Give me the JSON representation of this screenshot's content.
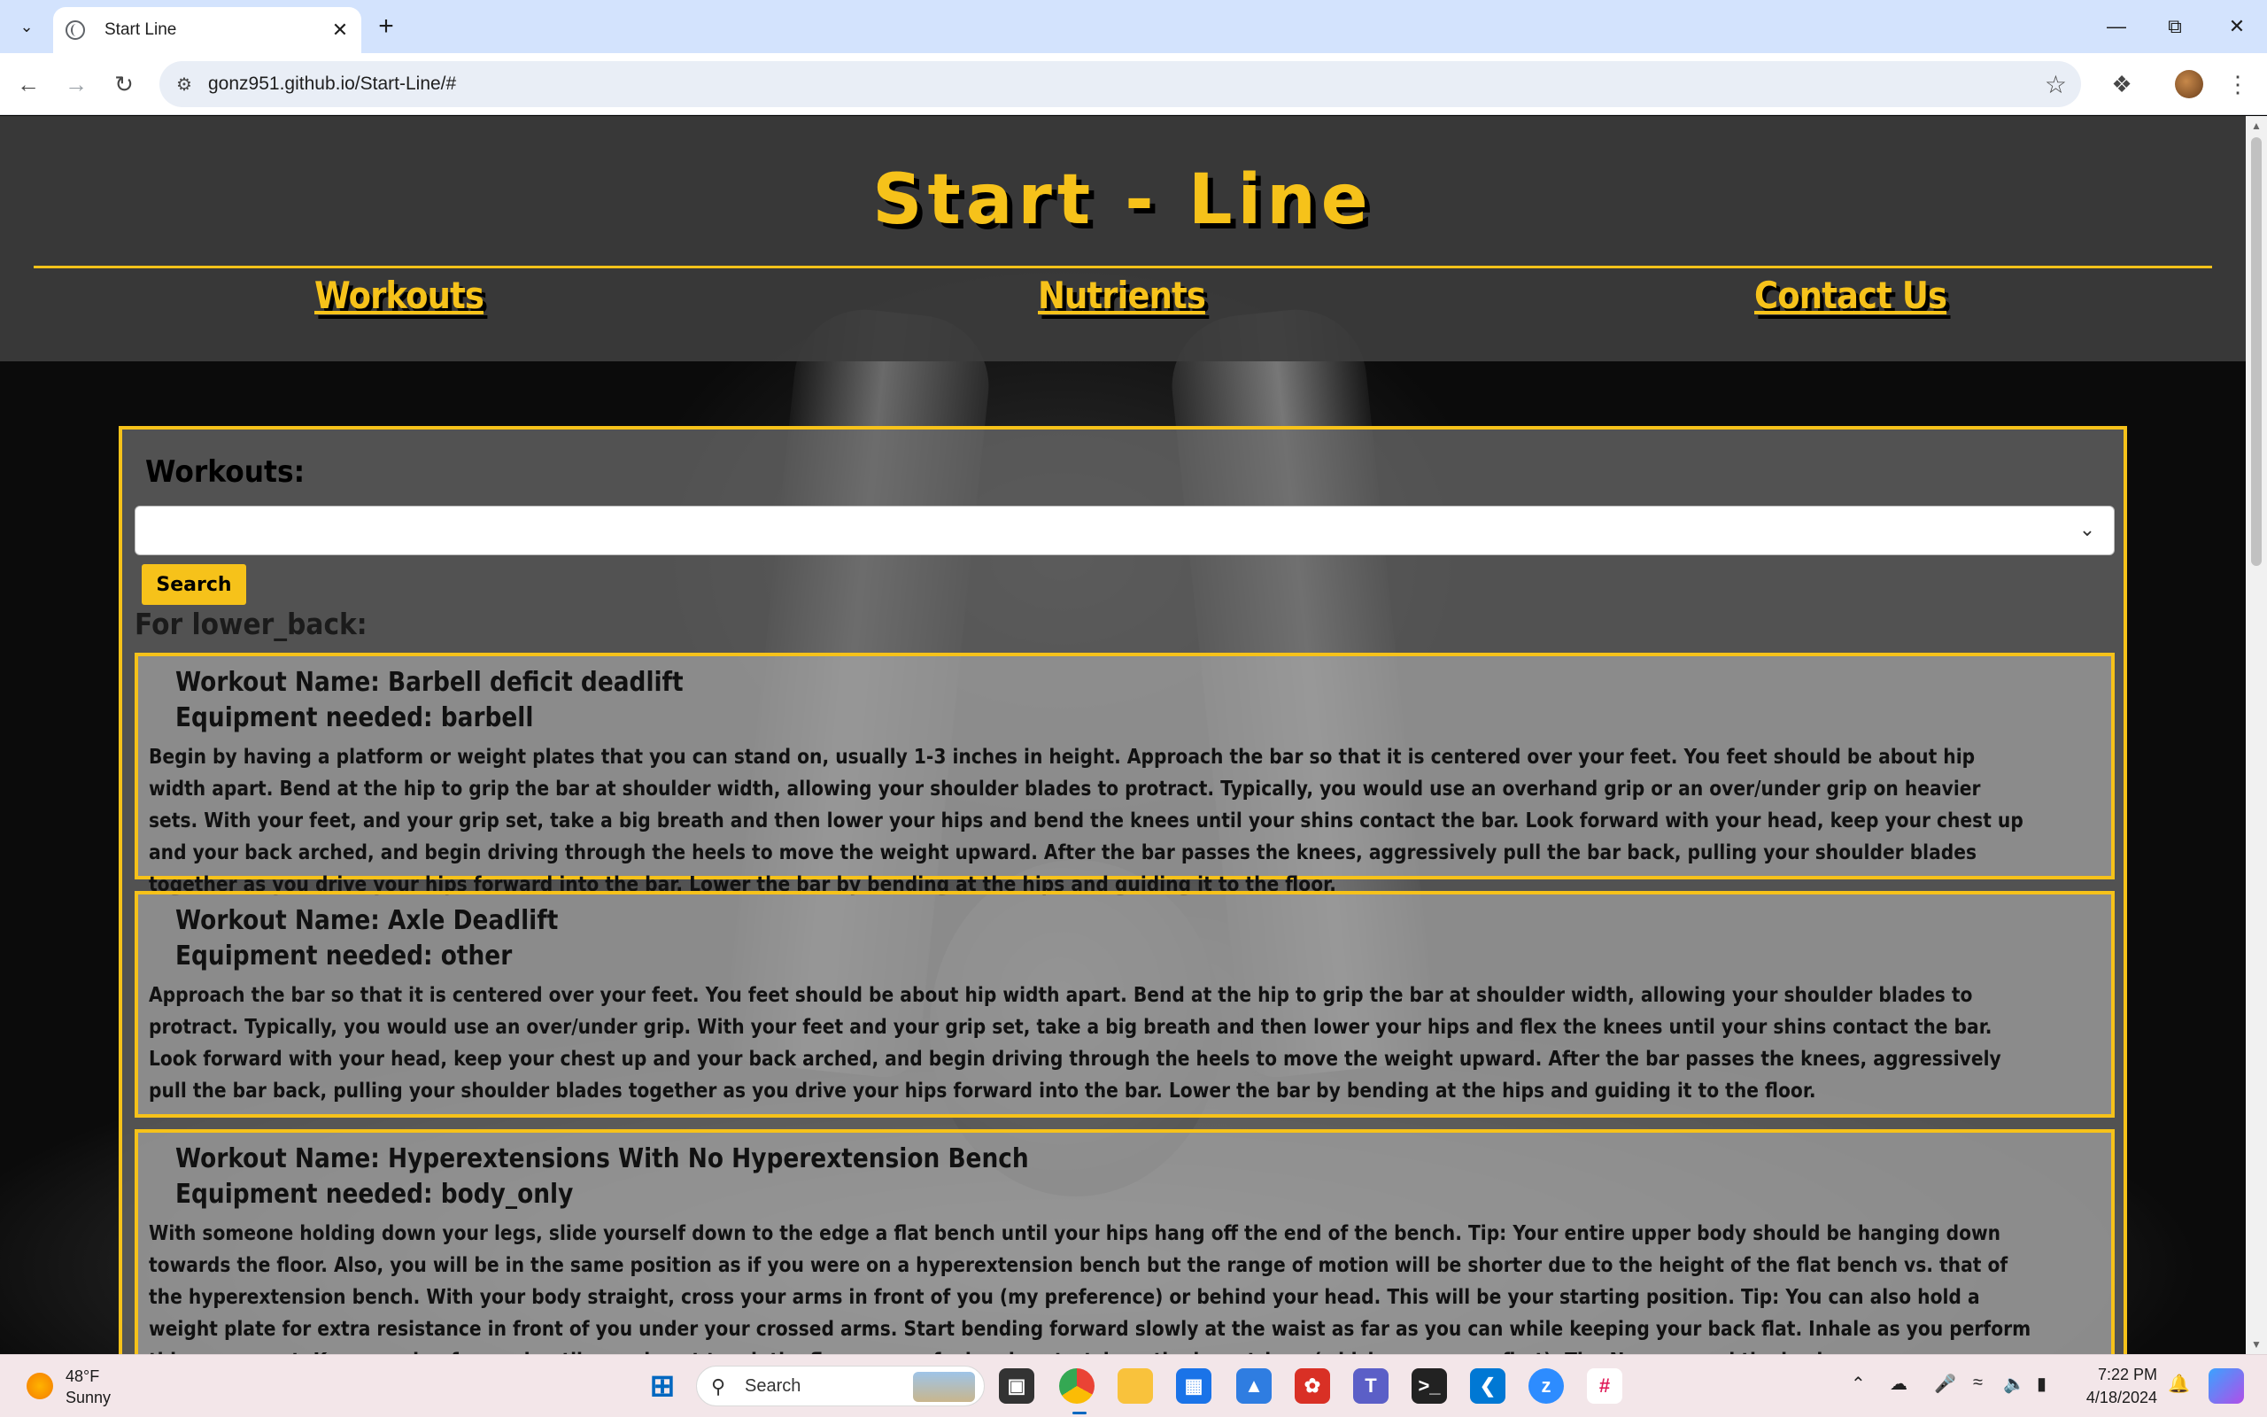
{
  "browser": {
    "tab_title": "Start Line",
    "url": "gonz951.github.io/Start-Line/#"
  },
  "site": {
    "title": "Start - Line",
    "nav": [
      "Workouts",
      "Nutrients",
      "Contact Us"
    ]
  },
  "panel": {
    "heading": "Workouts:",
    "select_value": "",
    "search_label": "Search",
    "results_for": "For lower_back:"
  },
  "results": [
    {
      "name": "Workout Name: Barbell deficit deadlift",
      "equipment": "Equipment needed: barbell",
      "description": "Begin by having a platform or weight plates that you can stand on, usually 1-3 inches in height. Approach the bar so that it is centered over your feet. You feet should be about hip width apart. Bend at the hip to grip the bar at shoulder width, allowing your shoulder blades to protract. Typically, you would use an overhand grip or an over/under grip on heavier sets. With your feet, and your grip set, take a big breath and then lower your hips and bend the knees until your shins contact the bar. Look forward with your head, keep your chest up and your back arched, and begin driving through the heels to move the weight upward. After the bar passes the knees, aggressively pull the bar back, pulling your shoulder blades together as you drive your hips forward into the bar. Lower the bar by bending at the hips and guiding it to the floor."
    },
    {
      "name": "Workout Name: Axle Deadlift",
      "equipment": "Equipment needed: other",
      "description": "Approach the bar so that it is centered over your feet. You feet should be about hip width apart. Bend at the hip to grip the bar at shoulder width, allowing your shoulder blades to protract. Typically, you would use an over/under grip. With your feet and your grip set, take a big breath and then lower your hips and flex the knees until your shins contact the bar. Look forward with your head, keep your chest up and your back arched, and begin driving through the heels to move the weight upward. After the bar passes the knees, aggressively pull the bar back, pulling your shoulder blades together as you drive your hips forward into the bar. Lower the bar by bending at the hips and guiding it to the floor."
    },
    {
      "name": "Workout Name: Hyperextensions With No Hyperextension Bench",
      "equipment": "Equipment needed: body_only",
      "description": "With someone holding down your legs, slide yourself down to the edge a flat bench until your hips hang off the end of the bench. Tip: Your entire upper body should be hanging down towards the floor. Also, you will be in the same position as if you were on a hyperextension bench but the range of motion will be shorter due to the height of the flat bench vs. that of the hyperextension bench. With your body straight, cross your arms in front of you (my preference) or behind your head. This will be your starting position. Tip: You can also hold a weight plate for extra resistance in front of you under your crossed arms. Start bending forward slowly at the waist as far as you can while keeping your back flat. Inhale as you perform this movement. Keep moving forward until you almost touch the floor or you feel a nice stretch on the hamstrings (whichever comes first). Tip: Never round the back as you"
    }
  ],
  "taskbar": {
    "temperature": "48°F",
    "weather": "Sunny",
    "search_placeholder": "Search",
    "time": "7:22 PM",
    "date": "4/18/2024"
  },
  "colors": {
    "accent": "#f6c21a",
    "header_bg": "#3c3c3c"
  }
}
